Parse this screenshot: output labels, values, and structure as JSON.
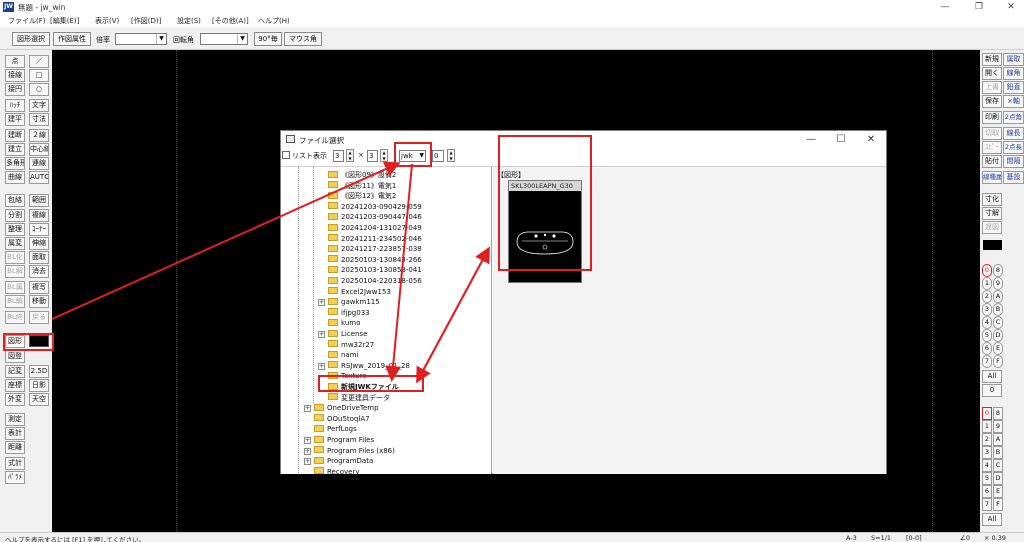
{
  "window": {
    "title": "無題 - jw_win",
    "app_icon": "JW",
    "controls": [
      "minimize-icon",
      "restore-icon",
      "close-icon"
    ]
  },
  "menu": [
    "ファイル(F)",
    "[編集(E)]",
    "表示(V)",
    "[作図(D)]",
    "設定(S)",
    "[その他(A)]",
    "ヘルプ(H)"
  ],
  "toolbar": {
    "shape_select": "図形選択",
    "draw_attr": "作図属性",
    "scale_label": "倍率",
    "scale_value": "",
    "rotation_label": "回転角",
    "rotation_value": "",
    "rot90": "90°毎",
    "mouse_angle": "マウス角"
  },
  "left_tools": [
    [
      "点",
      "／"
    ],
    [
      "接線",
      "□"
    ],
    [
      "接円",
      "○"
    ],
    [
      "ﾊｯﾁ",
      "文字"
    ],
    [
      "建平",
      "寸法"
    ],
    [
      "建断",
      "２線"
    ],
    [
      "建立",
      "中心線"
    ],
    [
      "多角形",
      "連線"
    ],
    [
      "曲線",
      "AUTO"
    ],
    [
      "包絡",
      "範囲"
    ],
    [
      "分割",
      "複線"
    ],
    [
      "整理",
      "ｺｰﾅｰ"
    ],
    [
      "属変",
      "伸縮"
    ],
    [
      "BL化",
      "面取"
    ],
    [
      "BL解",
      "消去"
    ],
    [
      "BL属",
      "複写"
    ],
    [
      "BL編",
      "移動"
    ],
    [
      "BL終",
      ""
    ],
    [
      "図形",
      ""
    ],
    [
      "図登",
      ""
    ],
    [
      "記変",
      "2.5D"
    ],
    [
      "座標",
      "日影"
    ],
    [
      "外変",
      "天空"
    ],
    [
      "測定",
      ""
    ],
    [
      "表計",
      ""
    ],
    [
      "距離",
      ""
    ],
    [
      "式計",
      ""
    ],
    [
      "ﾊﾟﾗﾒ",
      ""
    ]
  ],
  "right_tools": {
    "col1": [
      "新規",
      "開く",
      "上書",
      "保存",
      "印刷",
      "切取",
      "ｺﾋﾟｰ",
      "貼付",
      "線種属性"
    ],
    "col2": [
      "属取",
      "線角",
      "鉛直",
      "×軸",
      "2点角",
      "線長",
      "2点長",
      "間隔",
      "基設"
    ],
    "mid": [
      "寸化",
      "寸解",
      "遅図"
    ],
    "layer_groups": [
      "0",
      "8",
      "1",
      "9",
      "2",
      "A",
      "3",
      "B",
      "4",
      "C",
      "5",
      "D",
      "6",
      "E",
      "7",
      "F"
    ],
    "layers": [
      "0",
      "8",
      "1",
      "9",
      "2",
      "A",
      "3",
      "B",
      "4",
      "C",
      "5",
      "D",
      "6",
      "E",
      "7",
      "F"
    ],
    "all_label": "All",
    "all_value": "0"
  },
  "status": {
    "help": "ヘルプを表示するには [F1] を押してください。",
    "paper": "A-3",
    "scale": "S=1/1",
    "layer": "[0-0]",
    "angle": "∠0",
    "zoom": "× 0.39"
  },
  "dialog": {
    "title": "ファイル選択",
    "list_label": "リスト表示",
    "cols": "3",
    "times": "×",
    "rows": "3",
    "ext": "jwk",
    "num": "0",
    "tree": [
      {
        "label": "《図形09》設備2",
        "indent": 2
      },
      {
        "label": "《図形11》電気1",
        "indent": 2
      },
      {
        "label": "《図形12》電気2",
        "indent": 2
      },
      {
        "label": "20241203-090429-059",
        "indent": 2
      },
      {
        "label": "20241203-090447-046",
        "indent": 2
      },
      {
        "label": "20241204-131027-049",
        "indent": 2
      },
      {
        "label": "20241211-234502-046",
        "indent": 2
      },
      {
        "label": "20241217-223857-038",
        "indent": 2
      },
      {
        "label": "20250103-130843-266",
        "indent": 2
      },
      {
        "label": "20250103-130853-041",
        "indent": 2
      },
      {
        "label": "20250104-220318-056",
        "indent": 2
      },
      {
        "label": "Excel2Jww153",
        "indent": 2
      },
      {
        "label": "gawkm115",
        "indent": 2,
        "plus": true
      },
      {
        "label": "ifjpg033",
        "indent": 2
      },
      {
        "label": "kumo",
        "indent": 2
      },
      {
        "label": "License",
        "indent": 2,
        "plus": true
      },
      {
        "label": "mw32r27",
        "indent": 2
      },
      {
        "label": "nami",
        "indent": 2
      },
      {
        "label": "RSJww_2019_01_28",
        "indent": 2,
        "plus": true
      },
      {
        "label": "Texture",
        "indent": 2
      },
      {
        "label": "新規JWKファイル",
        "indent": 2,
        "selected": true
      },
      {
        "label": "変更建具データ",
        "indent": 2
      },
      {
        "label": "OneDriveTemp",
        "indent": 1,
        "plus": true
      },
      {
        "label": "OOu5toqlA7",
        "indent": 1
      },
      {
        "label": "PerfLogs",
        "indent": 1
      },
      {
        "label": "Program Files",
        "indent": 1,
        "plus": true
      },
      {
        "label": "Program Files (x86)",
        "indent": 1,
        "plus": true
      },
      {
        "label": "ProgramData",
        "indent": 1,
        "plus": true
      },
      {
        "label": "Recovery",
        "indent": 1
      }
    ],
    "preview_label": "【図形】",
    "thumb_name": "SKL300LEAPN_G30"
  },
  "colors": {
    "highlight": "#e02020",
    "canvas": "#000000",
    "folder": "#f1cf5c",
    "accent_blue": "#1f3fa0"
  }
}
